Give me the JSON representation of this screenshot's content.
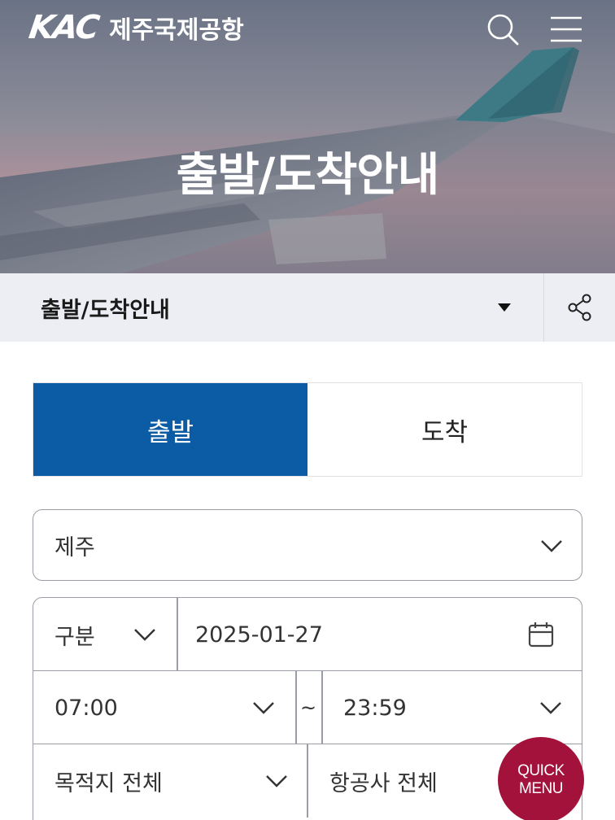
{
  "header": {
    "logo_mark": "KAC",
    "logo_text": "제주국제공항",
    "search_icon": "search-icon",
    "menu_icon": "hamburger-menu-icon"
  },
  "hero": {
    "title": "출발/도착안내"
  },
  "breadcrumb": {
    "label": "출발/도착안내",
    "caret_icon": "caret-down-icon",
    "share_icon": "share-icon"
  },
  "tabs": [
    {
      "label": "출발",
      "active": true
    },
    {
      "label": "도착",
      "active": false
    }
  ],
  "airport": {
    "value": "제주"
  },
  "filters": {
    "type_label": "구분",
    "date_value": "2025-01-27",
    "start_time": "07:00",
    "time_separator": "~",
    "end_time": "23:59",
    "destination": "목적지 전체",
    "airline": "항공사 전체"
  },
  "quick_menu": {
    "line1": "QUICK",
    "line2": "MENU",
    "color": "#a3123a"
  },
  "colors": {
    "primary": "#0b5ca5",
    "breadcrumb_bg": "#eceef3"
  }
}
